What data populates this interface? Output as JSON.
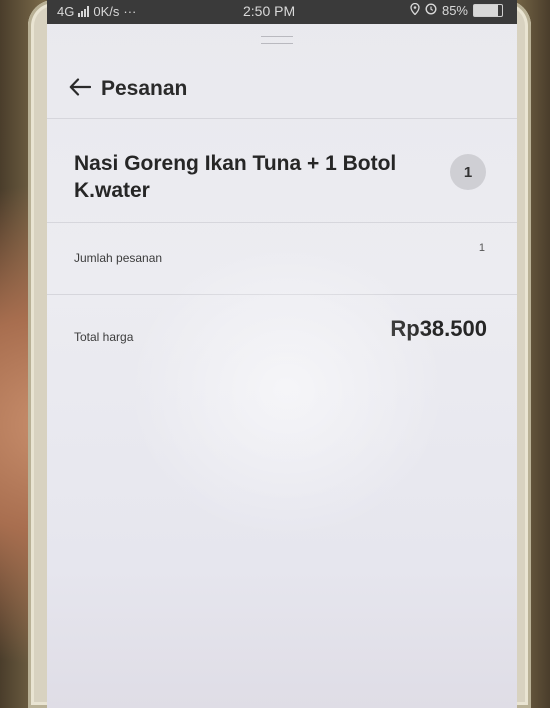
{
  "status_bar": {
    "network": "4G",
    "speed": "0K/s",
    "more": "···",
    "time": "2:50 PM",
    "battery": "85%"
  },
  "header": {
    "back_icon": "arrow-left-icon",
    "title": "Pesanan"
  },
  "order_item": {
    "name": "Nasi Goreng Ikan Tuna + 1 Botol K.water",
    "quantity": "1"
  },
  "summary": {
    "count_label": "Jumlah pesanan",
    "count_value": "1",
    "total_label": "Total harga",
    "total_value": "Rp38.500"
  },
  "colors": {
    "screen_bg": "#ebebf0",
    "status_bar_bg": "#3a3a3a",
    "text_primary": "#262626",
    "badge_bg": "#cfcfd4",
    "divider": "#d6d6dc"
  }
}
